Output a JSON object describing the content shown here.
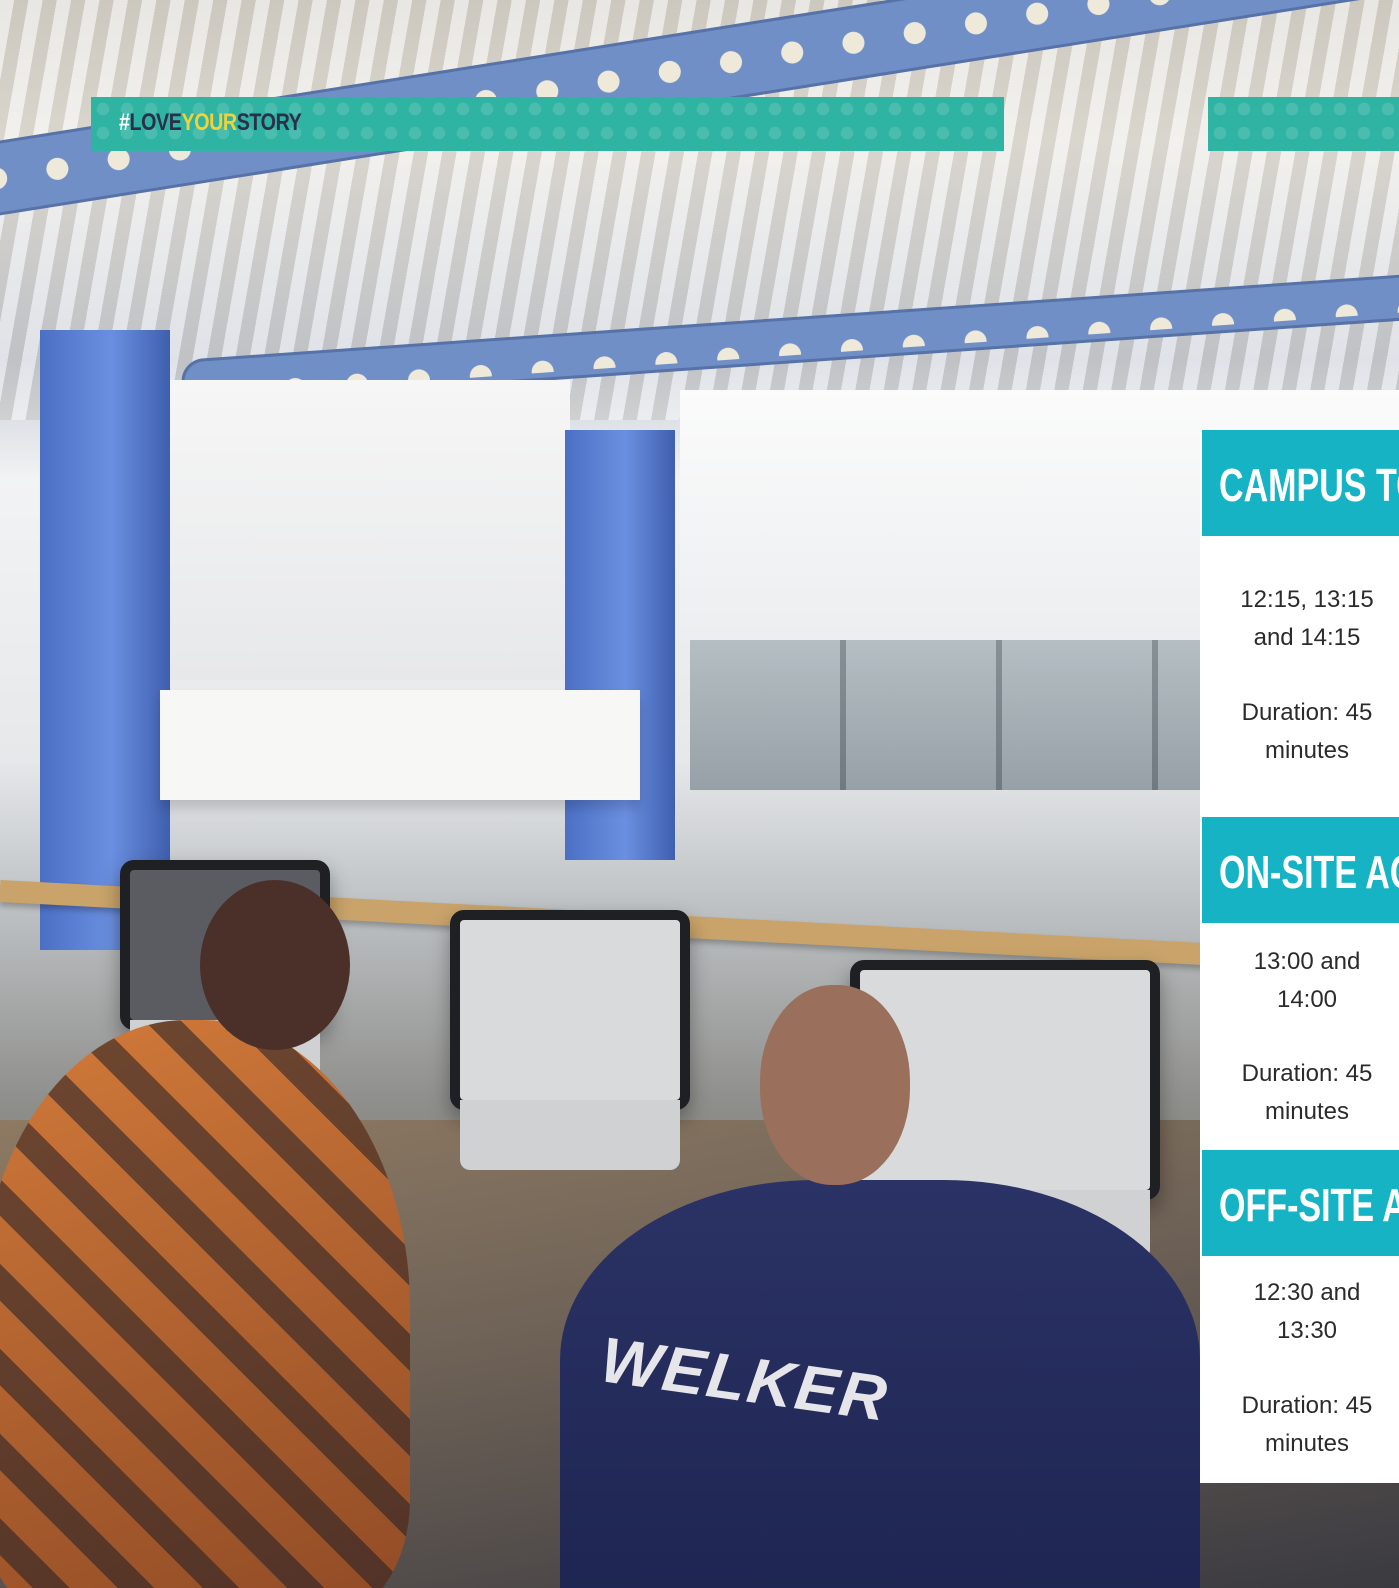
{
  "banner": {
    "hashtag": {
      "hash": "#",
      "love": "LOVE",
      "your": "YOUR",
      "story": "STORY"
    },
    "colors": {
      "background": "#2fb3a3",
      "hash": "#ffffff",
      "love": "#2c2f4a",
      "your": "#f2d23a",
      "story": "#2c2f4a"
    }
  },
  "photo": {
    "jersey_text": "WELKER"
  },
  "sections": [
    {
      "title": "CAMPUS TO",
      "times": "12:15, 13:15 and 14:15",
      "duration": "Duration: 45 minutes"
    },
    {
      "title": "ON-SITE AC",
      "times": "13:00 and 14:00",
      "duration": "Duration: 45 minutes"
    },
    {
      "title": "OFF-SITE A",
      "times": "12:30 and 13:30",
      "duration": "Duration: 45 minutes"
    }
  ],
  "panel_colors": {
    "header": "#16b3c4",
    "body": "#ffffff",
    "text": "#2b2b2b"
  }
}
